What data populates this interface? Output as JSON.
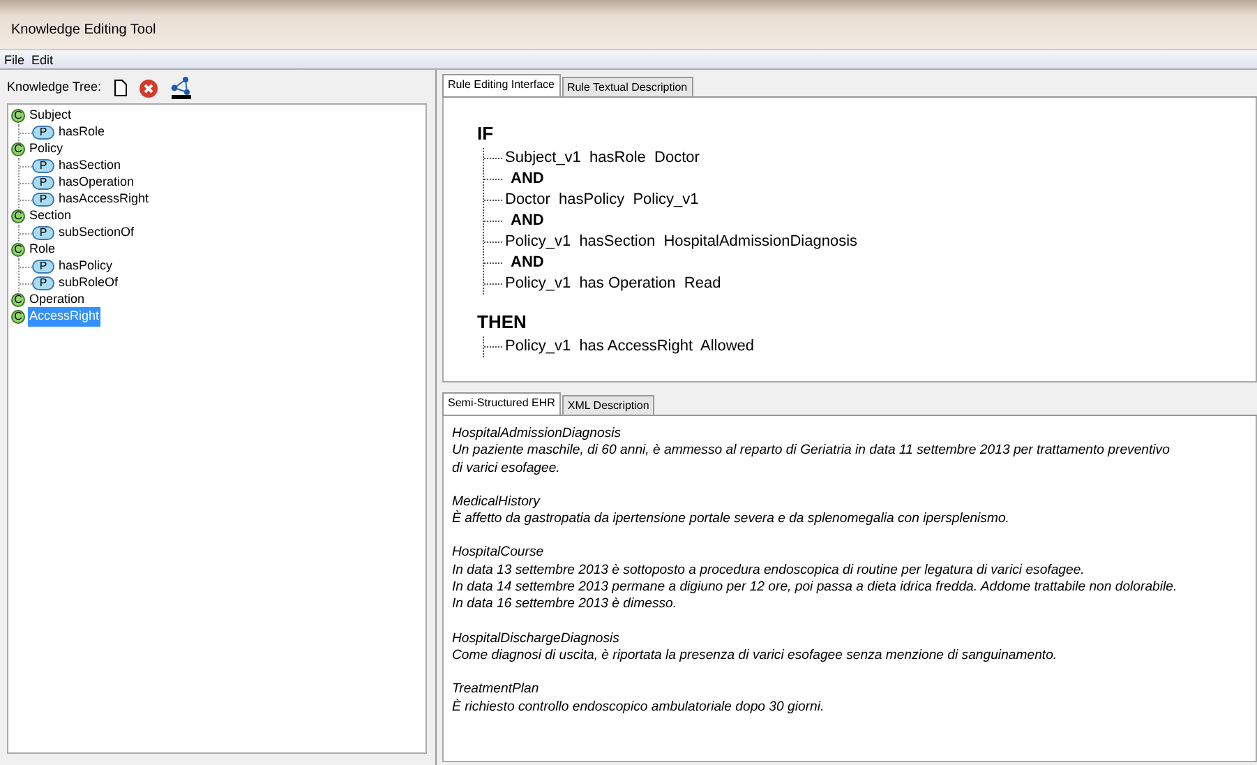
{
  "window": {
    "title": "Knowledge Editing Tool"
  },
  "menu": [
    "File",
    "Edit"
  ],
  "knowledge_tree": {
    "label": "Knowledge Tree:",
    "items": [
      {
        "kind": "class",
        "badge": "C",
        "label": "Subject",
        "selected": false,
        "children": [
          {
            "kind": "property",
            "badge": "P",
            "label": "hasRole",
            "selected": false
          }
        ]
      },
      {
        "kind": "class",
        "badge": "C",
        "label": "Policy",
        "selected": false,
        "children": [
          {
            "kind": "property",
            "badge": "P",
            "label": "hasSection",
            "selected": false
          },
          {
            "kind": "property",
            "badge": "P",
            "label": "hasOperation",
            "selected": false
          },
          {
            "kind": "property",
            "badge": "P",
            "label": "hasAccessRight",
            "selected": false
          }
        ]
      },
      {
        "kind": "class",
        "badge": "C",
        "label": "Section",
        "selected": false,
        "children": [
          {
            "kind": "property",
            "badge": "P",
            "label": "subSectionOf",
            "selected": false
          }
        ]
      },
      {
        "kind": "class",
        "badge": "C",
        "label": "Role",
        "selected": false,
        "children": [
          {
            "kind": "property",
            "badge": "P",
            "label": "hasPolicy",
            "selected": false
          },
          {
            "kind": "property",
            "badge": "P",
            "label": "subRoleOf",
            "selected": false
          }
        ]
      },
      {
        "kind": "class",
        "badge": "C",
        "label": "Operation",
        "selected": false
      },
      {
        "kind": "class",
        "badge": "C",
        "label": "AccessRight",
        "selected": true
      }
    ]
  },
  "rule_panel": {
    "tabs": [
      {
        "label": "Rule Editing Interface",
        "selected": true
      },
      {
        "label": "Rule Textual Description",
        "selected": false
      }
    ],
    "if_label": "IF",
    "conditions": [
      {
        "kind": "triple",
        "text": "Subject_v1  hasRole  Doctor"
      },
      {
        "kind": "operator",
        "text": "AND"
      },
      {
        "kind": "triple",
        "text": "Doctor  hasPolicy  Policy_v1"
      },
      {
        "kind": "operator",
        "text": "AND"
      },
      {
        "kind": "triple",
        "text": "Policy_v1  hasSection  HospitalAdmissionDiagnosis"
      },
      {
        "kind": "operator",
        "text": "AND"
      },
      {
        "kind": "triple",
        "text": "Policy_v1  has Operation  Read"
      }
    ],
    "then_label": "THEN",
    "conclusions": [
      {
        "kind": "triple",
        "text": "Policy_v1  has AccessRight  Allowed"
      }
    ]
  },
  "ehr_panel": {
    "tabs": [
      {
        "label": "Semi-Structured EHR",
        "selected": true
      },
      {
        "label": "XML Description",
        "selected": false
      }
    ],
    "sections": [
      {
        "heading": "HospitalAdmissionDiagnosis",
        "lines": [
          "Un paziente maschile, di 60 anni, è ammesso al reparto di Geriatria in data 11 settembre 2013 per trattamento preventivo",
          "di varici esofagee."
        ]
      },
      {
        "heading": "MedicalHistory",
        "lines": [
          "È affetto da gastropatia da ipertensione portale severa e da splenomegalia con ipersplenismo."
        ]
      },
      {
        "heading": "HospitalCourse",
        "lines": [
          "In data 13 settembre 2013 è sottoposto a procedura endoscopica di routine per legatura di varici esofagee.",
          "In data 14 settembre 2013 permane a digiuno per 12 ore, poi passa a dieta idrica fredda. Addome trattabile non dolorabile.",
          "In data 16 settembre 2013 è dimesso."
        ]
      },
      {
        "heading": "HospitalDischargeDiagnosis",
        "lines": [
          "Come diagnosi di uscita, è riportata la presenza di varici esofagee senza menzione di sanguinamento."
        ]
      },
      {
        "heading": "TreatmentPlan",
        "lines": [
          "È richiesto controllo endoscopico ambulatoriale dopo 30 giorni."
        ]
      }
    ]
  }
}
